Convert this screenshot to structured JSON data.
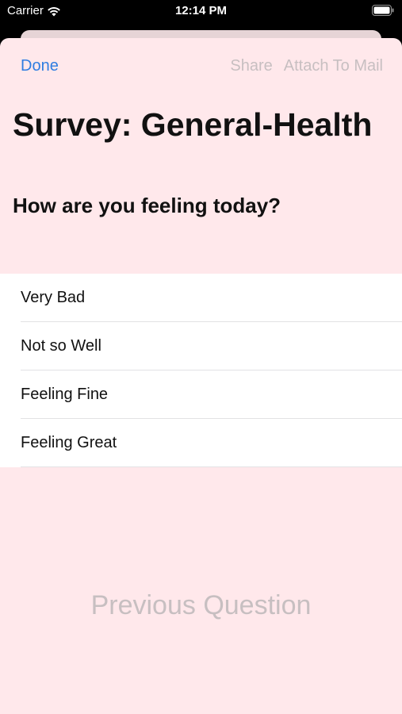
{
  "status_bar": {
    "carrier": "Carrier",
    "time": "12:14 PM",
    "icons": [
      "wifi-icon",
      "battery-icon"
    ]
  },
  "nav": {
    "done_label": "Done",
    "share_label": "Share",
    "attach_label": "Attach To Mail"
  },
  "survey": {
    "title": "Survey: General-Health",
    "question": "How are you feeling today?",
    "options": [
      "Very Bad",
      "Not so Well",
      "Feeling Fine",
      "Feeling Great"
    ],
    "previous_label": "Previous Question"
  },
  "colors": {
    "sheet_background": "#ffe8eb",
    "accent": "#2f7de1",
    "disabled_text": "#c7bfc1"
  }
}
